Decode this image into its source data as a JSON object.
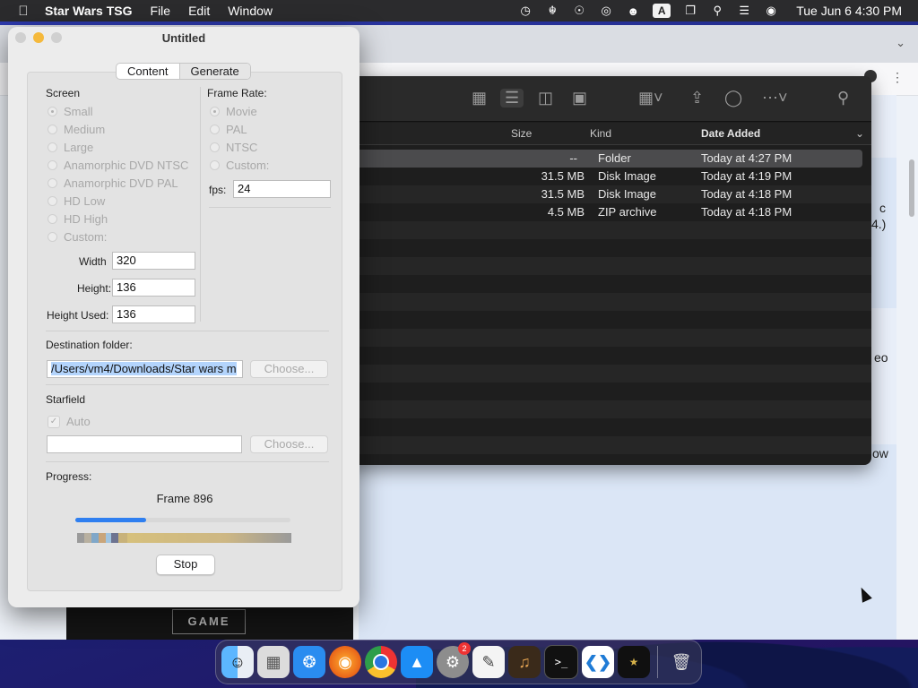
{
  "menubar": {
    "app_name": "Star Wars TSG",
    "menus": [
      "File",
      "Edit",
      "Window"
    ],
    "status_icons": [
      "time-machine-icon",
      "hearing-icon",
      "accessibility-icon",
      "airplay-icon",
      "user-icon",
      "input-source-icon",
      "screen-mirroring-icon",
      "search-icon",
      "control-center-icon",
      "siri-icon"
    ],
    "input_source_label": "A",
    "clock": "Tue Jun 6  4:30 PM"
  },
  "browser": {
    "edge_texts": [
      "c",
      "4.)",
      "eo",
      "ow"
    ]
  },
  "finder": {
    "columns": {
      "size": "Size",
      "kind": "Kind",
      "date_added": "Date Added"
    },
    "rows": [
      {
        "size": "--",
        "kind": "Folder",
        "date": "Today at 4:27 PM"
      },
      {
        "size": "31.5 MB",
        "kind": "Disk Image",
        "date": "Today at 4:19 PM"
      },
      {
        "size": "31.5 MB",
        "kind": "Disk Image",
        "date": "Today at 4:18 PM"
      },
      {
        "size": "4.5 MB",
        "kind": "ZIP archive",
        "date": "Today at 4:18 PM"
      }
    ]
  },
  "dialog": {
    "title": "Untitled",
    "tabs": [
      "Content",
      "Generate"
    ],
    "screen": {
      "label": "Screen",
      "options": [
        "Small",
        "Medium",
        "Large",
        "Anamorphic DVD NTSC",
        "Anamorphic DVD PAL",
        "HD Low",
        "HD High",
        "Custom:"
      ],
      "width_label": "Width",
      "width_value": "320",
      "height_label": "Height:",
      "height_value": "136",
      "height_used_label": "Height Used:",
      "height_used_value": "136"
    },
    "frame_rate": {
      "label": "Frame Rate:",
      "options": [
        "Movie",
        "PAL",
        "NTSC",
        "Custom:"
      ],
      "fps_label": "fps:",
      "fps_value": "24"
    },
    "destination": {
      "label": "Destination folder:",
      "path": "/Users/vm4/Downloads/Star wars m",
      "choose_label": "Choose..."
    },
    "starfield": {
      "label": "Starfield",
      "auto_label": "Auto",
      "path": "",
      "choose_label": "Choose..."
    },
    "progress": {
      "label": "Progress:",
      "frame_text": "Frame 896",
      "fraction": 0.33,
      "stop_label": "Stop"
    }
  },
  "poster": {
    "logo_text": "GAME"
  },
  "dock": {
    "items": [
      "finder-icon",
      "launchpad-icon",
      "safari-icon",
      "firefox-icon",
      "chrome-icon",
      "app-store-icon",
      "system-settings-icon",
      "textedit-icon",
      "garageband-icon",
      "terminal-icon",
      "vscode-icon",
      "star-wars-tsg-icon",
      "trash-icon"
    ],
    "settings_badge": "2"
  },
  "colors": {
    "accent": "#2f7ff0",
    "close": "#d0d0d0",
    "minimize": "#f5b93c",
    "zoom": "#d0d0d0"
  }
}
